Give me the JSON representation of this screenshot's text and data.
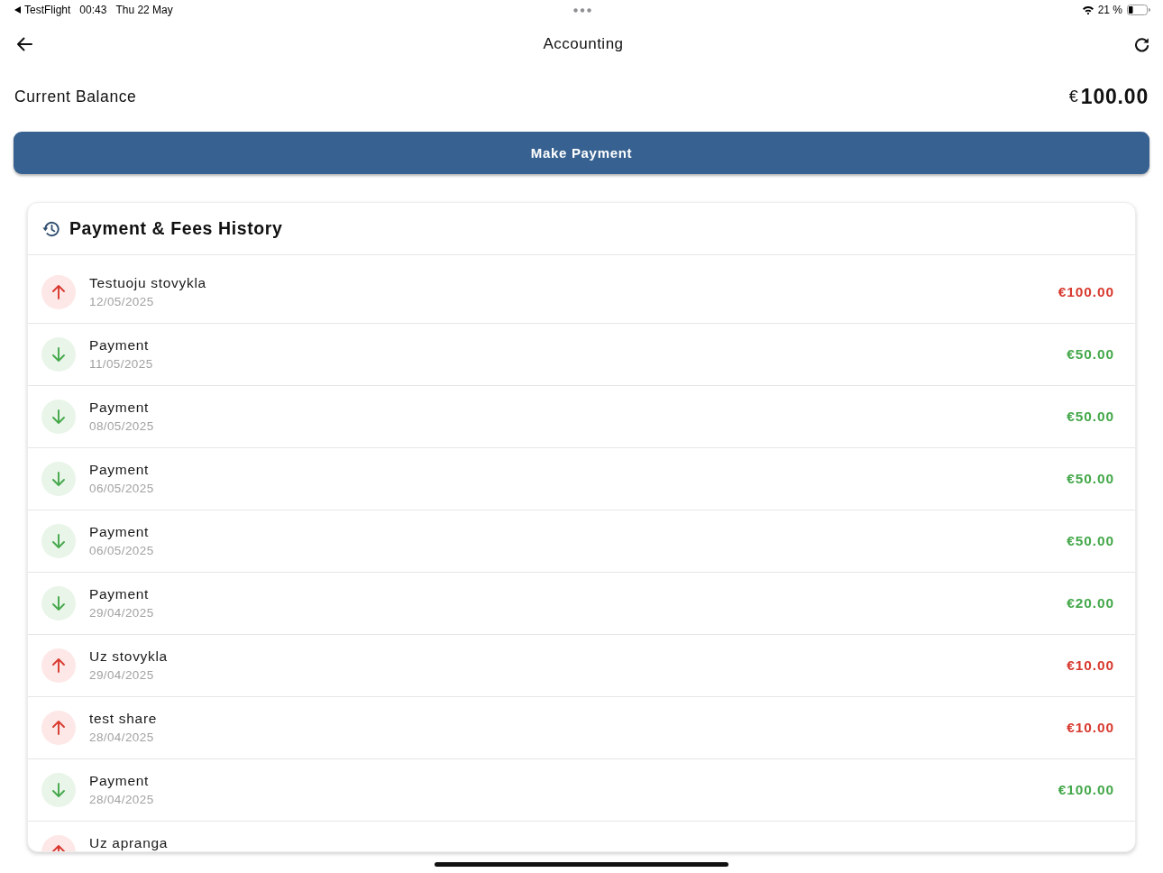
{
  "status_bar": {
    "back_app": "TestFlight",
    "time": "00:43",
    "date": "Thu 22 May",
    "battery": "21 %"
  },
  "header": {
    "title": "Accounting"
  },
  "balance": {
    "label": "Current Balance",
    "currency": "€",
    "amount": "100.00"
  },
  "pay_button": {
    "label": "Make Payment"
  },
  "history": {
    "title": "Payment & Fees History",
    "items": [
      {
        "kind": "fee",
        "title": "Testuoju stovykla",
        "date": "12/05/2025",
        "amount": "€100.00"
      },
      {
        "kind": "payment",
        "title": "Payment",
        "date": "11/05/2025",
        "amount": "€50.00"
      },
      {
        "kind": "payment",
        "title": "Payment",
        "date": "08/05/2025",
        "amount": "€50.00"
      },
      {
        "kind": "payment",
        "title": "Payment",
        "date": "06/05/2025",
        "amount": "€50.00"
      },
      {
        "kind": "payment",
        "title": "Payment",
        "date": "06/05/2025",
        "amount": "€50.00"
      },
      {
        "kind": "payment",
        "title": "Payment",
        "date": "29/04/2025",
        "amount": "€20.00"
      },
      {
        "kind": "fee",
        "title": "Uz stovykla",
        "date": "29/04/2025",
        "amount": "€10.00"
      },
      {
        "kind": "fee",
        "title": "test share",
        "date": "28/04/2025",
        "amount": "€10.00"
      },
      {
        "kind": "payment",
        "title": "Payment",
        "date": "28/04/2025",
        "amount": "€100.00"
      },
      {
        "kind": "fee",
        "title": "Uz apranga"
      }
    ]
  }
}
